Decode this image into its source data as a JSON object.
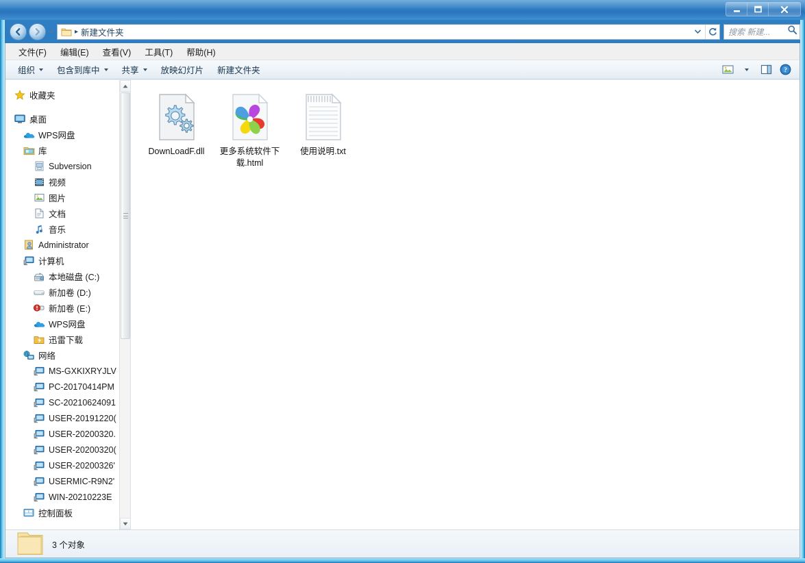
{
  "window": {
    "titlebar": {
      "minimize_label": "最小化",
      "maximize_label": "最大化",
      "close_label": "关闭"
    },
    "accent_color": "#2a73bd",
    "glass_color": "#4fc0e8"
  },
  "address_bar": {
    "back_label": "后退",
    "forward_label": "前进",
    "history_label": "最近浏览的位置",
    "breadcrumb": "新建文件夹",
    "separator": "▸",
    "dropdown_label": "前往",
    "refresh_label": "刷新"
  },
  "search": {
    "placeholder": "搜索 新建...",
    "icon": "search-icon"
  },
  "menubar": {
    "items": [
      {
        "label": "文件(F)"
      },
      {
        "label": "编辑(E)"
      },
      {
        "label": "查看(V)"
      },
      {
        "label": "工具(T)"
      },
      {
        "label": "帮助(H)"
      }
    ]
  },
  "command_bar": {
    "items": [
      {
        "label": "组织",
        "has_caret": true
      },
      {
        "label": "包含到库中",
        "has_caret": true
      },
      {
        "label": "共享",
        "has_caret": true
      },
      {
        "label": "放映幻灯片",
        "has_caret": false
      },
      {
        "label": "新建文件夹",
        "has_caret": false
      }
    ],
    "right_buttons": [
      {
        "name": "change-view-button",
        "label": "更改您的视图"
      },
      {
        "name": "view-dropdown-button",
        "label": "视图下拉"
      },
      {
        "name": "preview-pane-button",
        "label": "显示预览窗格"
      },
      {
        "name": "help-button",
        "label": "帮助"
      }
    ]
  },
  "nav_pane": {
    "items": [
      {
        "label": "收藏夹",
        "icon": "star-icon",
        "level": 0
      },
      {
        "label": "桌面",
        "icon": "desktop-icon",
        "level": 0,
        "gap_before": true
      },
      {
        "label": "WPS网盘",
        "icon": "cloud-icon",
        "level": 1
      },
      {
        "label": "库",
        "icon": "library-folder-icon",
        "level": 1
      },
      {
        "label": "Subversion",
        "icon": "subversion-icon",
        "level": 2
      },
      {
        "label": "视频",
        "icon": "video-icon",
        "level": 2
      },
      {
        "label": "图片",
        "icon": "picture-icon",
        "level": 2
      },
      {
        "label": "文档",
        "icon": "document-icon",
        "level": 2
      },
      {
        "label": "音乐",
        "icon": "music-icon",
        "level": 2
      },
      {
        "label": "Administrator",
        "icon": "user-icon",
        "level": 1
      },
      {
        "label": "计算机",
        "icon": "computer-icon",
        "level": 1
      },
      {
        "label": "本地磁盘 (C:)",
        "icon": "system-drive-icon",
        "level": 2
      },
      {
        "label": "新加卷 (D:)",
        "icon": "drive-icon",
        "level": 2
      },
      {
        "label": "新加卷 (E:)",
        "icon": "drive-warning-icon",
        "level": 2
      },
      {
        "label": "WPS网盘",
        "icon": "cloud-icon",
        "level": 2
      },
      {
        "label": "迅雷下载",
        "icon": "thunder-folder-icon",
        "level": 2
      },
      {
        "label": "网络",
        "icon": "network-icon",
        "level": 1
      },
      {
        "label": "MS-GXKIXRYJLV",
        "icon": "computer-node-icon",
        "level": 2
      },
      {
        "label": "PC-20170414PM",
        "icon": "computer-node-icon",
        "level": 2
      },
      {
        "label": "SC-20210624091",
        "icon": "computer-node-icon",
        "level": 2
      },
      {
        "label": "USER-20191220(",
        "icon": "computer-node-icon",
        "level": 2
      },
      {
        "label": "USER-20200320.",
        "icon": "computer-node-icon",
        "level": 2
      },
      {
        "label": "USER-20200320(",
        "icon": "computer-node-icon",
        "level": 2
      },
      {
        "label": "USER-20200326'",
        "icon": "computer-node-icon",
        "level": 2
      },
      {
        "label": "USERMIC-R9N2'",
        "icon": "computer-node-icon",
        "level": 2
      },
      {
        "label": "WIN-20210223E",
        "icon": "computer-node-icon",
        "level": 2
      },
      {
        "label": "控制面板",
        "icon": "control-panel-icon",
        "level": 1
      }
    ],
    "scrollbar": {
      "up_label": "向上滚动",
      "down_label": "向下滚动"
    }
  },
  "file_view": {
    "files": [
      {
        "name": "DownLoadF.dll",
        "icon": "dll-gear-icon"
      },
      {
        "name": "更多系统软件下载.html",
        "icon": "html-pinwheel-icon"
      },
      {
        "name": "使用说明.txt",
        "icon": "text-file-icon"
      }
    ]
  },
  "status_bar": {
    "icon": "folder-icon",
    "text": "3 个对象"
  }
}
